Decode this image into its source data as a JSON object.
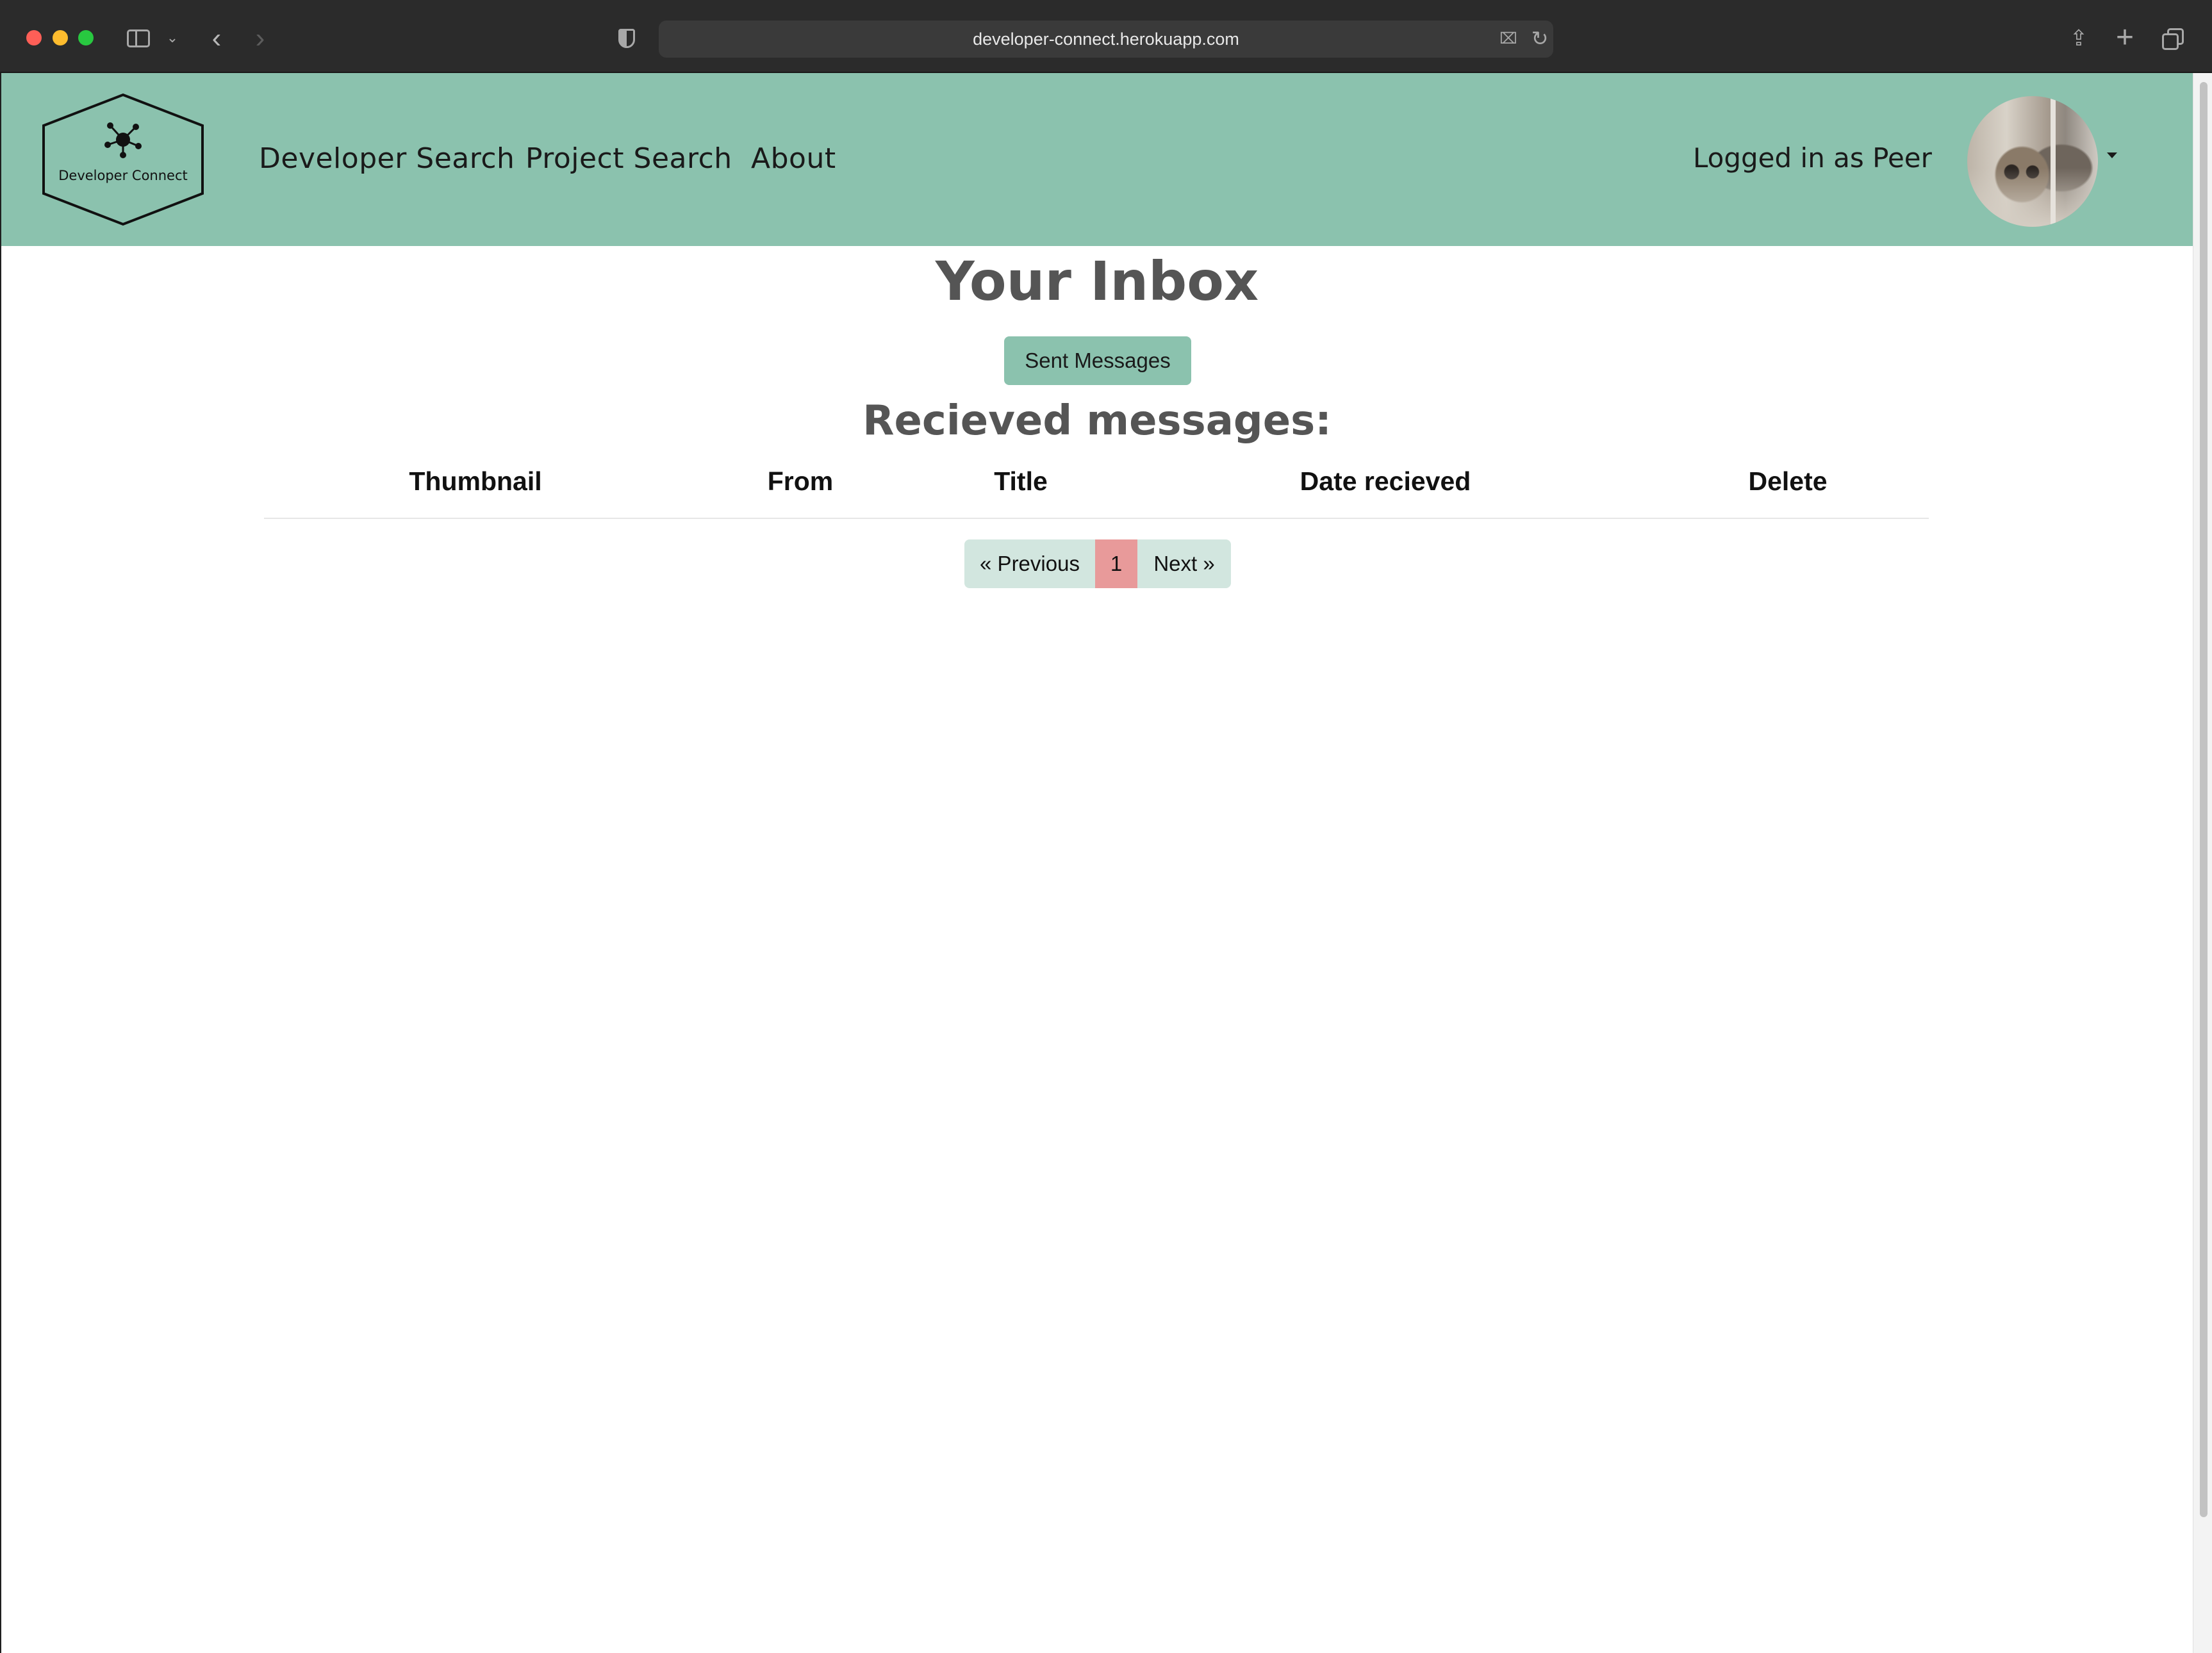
{
  "browser": {
    "url": "developer-connect.herokuapp.com"
  },
  "navbar": {
    "logo_text": "Developer Connect",
    "links": [
      {
        "label": "Developer Search"
      },
      {
        "label": "Project Search"
      },
      {
        "label": "About"
      }
    ],
    "user_status": "Logged in as Peer"
  },
  "inbox": {
    "title": "Your Inbox",
    "sent_button": "Sent Messages",
    "received_heading": "Recieved messages:",
    "columns": [
      "Thumbnail",
      "From",
      "Title",
      "Date recieved",
      "Delete"
    ],
    "rows": []
  },
  "pagination": {
    "previous": "« Previous",
    "current": "1",
    "next": "Next »"
  },
  "colors": {
    "navbar": "#8bc2ae",
    "active_page": "#e89a9a",
    "page_button": "#d2e6df",
    "heading_text": "#555555"
  }
}
